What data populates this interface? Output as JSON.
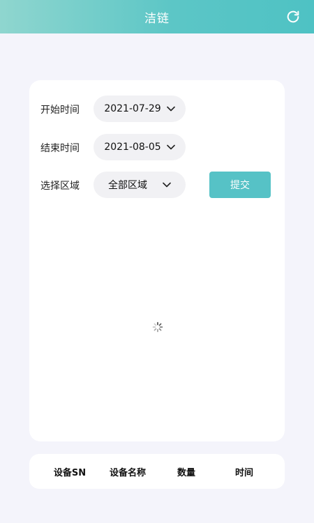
{
  "header": {
    "title": "洁链",
    "refresh_icon": "refresh-icon"
  },
  "filters": {
    "start": {
      "label": "开始时间",
      "value": "2021-07-29"
    },
    "end": {
      "label": "结束时间",
      "value": "2021-08-05"
    },
    "region": {
      "label": "选择区域",
      "value": "全部区域"
    },
    "submit_label": "提交"
  },
  "table": {
    "columns": [
      "设备SN",
      "设备名称",
      "数量",
      "时间"
    ]
  },
  "colors": {
    "accent": "#56c2c6",
    "header_gradient_start": "#8fd6cf",
    "header_gradient_end": "#4ec2c4",
    "page_bg": "#f4f4fb",
    "card_bg": "#ffffff",
    "pill_bg": "#f1f1f4"
  }
}
